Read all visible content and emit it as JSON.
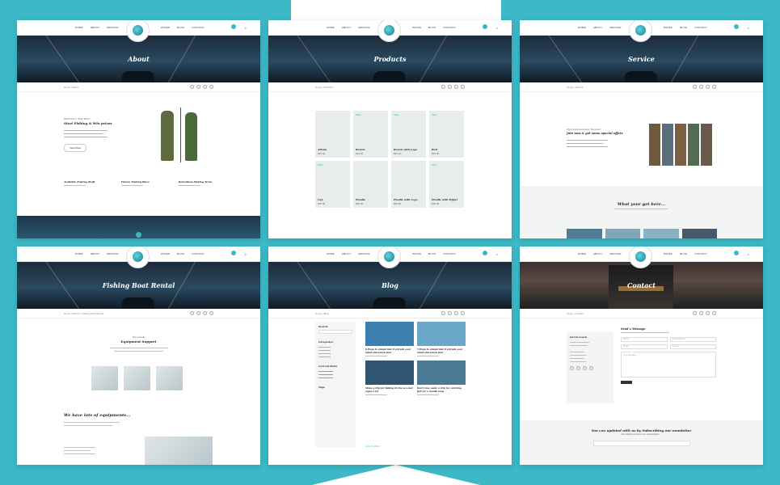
{
  "nav": {
    "left": [
      "Home",
      "About",
      "Service"
    ],
    "right": [
      "Pages",
      "Blog",
      "Contact"
    ]
  },
  "panels": {
    "about": {
      "title": "About",
      "crumb": "Home / About",
      "welcome": "Welcome to \"Reel 'Boat\"",
      "heading": "Start Fishing & Win prizes",
      "btn": "View More",
      "features": [
        "Available Fishing Stuff",
        "Future Fishing Place",
        "Relentless Fishing Team"
      ]
    },
    "products": {
      "title": "Products",
      "crumb": "Home / Products",
      "items": [
        "Album",
        "Beanie",
        "Beanie with Logo",
        "Belt",
        "Cap",
        "Hoodie",
        "Hoodie with Logo",
        "Hoodie with Zipper"
      ],
      "sale": "Sale!",
      "price": "$35.00"
    },
    "service": {
      "title": "Service",
      "crumb": "Home / Service",
      "kicker": "We provide exclusive \"Services\"",
      "heading": "Join now & get some special offers",
      "section": "What your get here..."
    },
    "rental": {
      "title": "Fishing Boat Rental",
      "crumb": "Home / Service / Fishing Boat Rental",
      "kicker": "We provide",
      "heading": "Equipment Support",
      "section": "We have lots of equipments..."
    },
    "blog": {
      "title": "Blog",
      "crumb": "Home / Blog",
      "sidebar": [
        "Search",
        "Categories",
        "Current Posts",
        "Tags"
      ],
      "posts": [
        "6 Ways to simple but it refresh your mind and touch dear",
        "5 Ways to simple but it refresh your mind and touch dear",
        "Make a trip for fishing in the sea and enjoy a lot",
        "Don't lose make a trip for catching fish for a month long"
      ],
      "date": "June 5, 2016"
    },
    "contact": {
      "title": "Contact",
      "crumb": "Home / Contact",
      "getintouch": "Get in touch",
      "sendmsg": "Send a Message",
      "fields": [
        "Name",
        "Email Address",
        "Phone",
        "Subject",
        "Your Message"
      ],
      "newsletter": "You can updated with us by Subscribing our newsletter",
      "sub": "Get daily post from our subscription..."
    }
  }
}
